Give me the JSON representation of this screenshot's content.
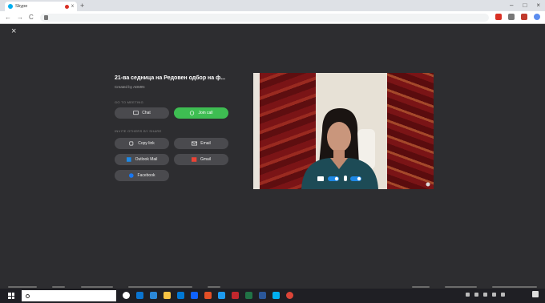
{
  "browser": {
    "tab_title": "Skype",
    "new_tab": "+",
    "tab_close": "x",
    "nav": {
      "back": "←",
      "forward": "→",
      "reload": "C"
    },
    "window_controls": {
      "minimize": "–",
      "maximize": "□",
      "close": "×"
    }
  },
  "meeting": {
    "close_label": "×",
    "title": "21-ва седница на Редовен одбор на ф...",
    "subtitle": "Created by ADMIN",
    "section_meeting": "GO TO MEETING",
    "chat_label": "Chat",
    "join_label": "Join call",
    "section_invite": "INVITE OTHERS BY SHARE",
    "copy_link_label": "Copy link",
    "email_label": "Email",
    "outlook_label": "Outlook Mail",
    "gmail_label": "Gmail",
    "facebook_label": "Facebook"
  },
  "colors": {
    "app_bg": "#2d2d30",
    "button_bg": "#4a4a4e",
    "join_green": "#3ebd52",
    "accent_blue": "#1e88e5"
  },
  "icons": [
    "chat-icon",
    "video-call-icon",
    "link-icon",
    "email-icon",
    "outlook-icon",
    "gmail-icon",
    "facebook-icon",
    "camera-icon",
    "mic-icon",
    "settings-icon",
    "search-icon",
    "windows-logo-icon"
  ]
}
